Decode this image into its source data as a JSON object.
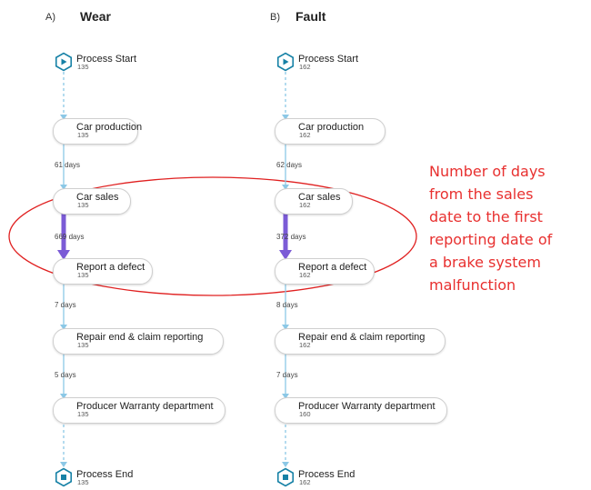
{
  "panels": [
    {
      "letter": "A)",
      "name": "Wear",
      "nodes": [
        {
          "title": "Process Start",
          "count": "135",
          "kind": "start"
        },
        {
          "title": "Car production",
          "count": "135",
          "kind": "activity"
        },
        {
          "title": "Car sales",
          "count": "135",
          "kind": "activity"
        },
        {
          "title": "Report a defect",
          "count": "135",
          "kind": "activity"
        },
        {
          "title": "Repair end & claim reporting",
          "count": "135",
          "kind": "activity"
        },
        {
          "title": "Producer Warranty department",
          "count": "135",
          "kind": "activity"
        },
        {
          "title": "Process End",
          "count": "135",
          "kind": "end"
        }
      ],
      "edge_labels": [
        "",
        "61 days",
        "669 days",
        "7 days",
        "5 days",
        ""
      ]
    },
    {
      "letter": "B)",
      "name": "Fault",
      "nodes": [
        {
          "title": "Process Start",
          "count": "162",
          "kind": "start"
        },
        {
          "title": "Car production",
          "count": "162",
          "kind": "activity"
        },
        {
          "title": "Car sales",
          "count": "162",
          "kind": "activity"
        },
        {
          "title": "Report a defect",
          "count": "162",
          "kind": "activity"
        },
        {
          "title": "Repair end & claim reporting",
          "count": "162",
          "kind": "activity"
        },
        {
          "title": "Producer Warranty department",
          "count": "160",
          "kind": "activity-light"
        },
        {
          "title": "Process End",
          "count": "162",
          "kind": "end"
        }
      ],
      "edge_labels": [
        "",
        "62 days",
        "372 days",
        "8 days",
        "7 days",
        ""
      ]
    }
  ],
  "annotation": {
    "lines": [
      "Number of days",
      "from the sales",
      "date to the first",
      "reporting date of",
      "a brake system",
      "malfunction"
    ],
    "color": "#e8302f"
  },
  "colors": {
    "node_dark": "#1681a6",
    "node_light": "#a9dcf0",
    "edge_light": "#8cc8e6",
    "edge_highlight": "#7b5bd6",
    "ellipse": "#e02020"
  }
}
